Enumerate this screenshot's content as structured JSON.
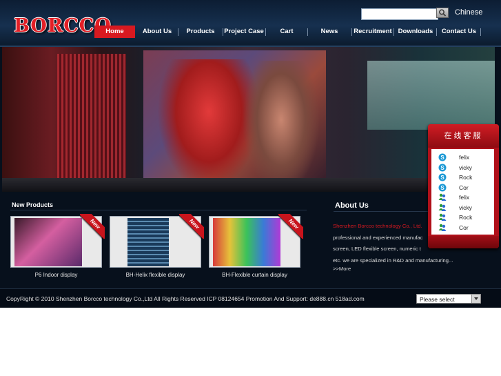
{
  "header": {
    "logo_text": "BORCCO",
    "search_placeholder": "",
    "language_link": "Chinese"
  },
  "nav": {
    "items": [
      {
        "label": "Home",
        "active": true
      },
      {
        "label": "About Us"
      },
      {
        "label": "Products"
      },
      {
        "label": "Project Case"
      },
      {
        "label": "Cart"
      },
      {
        "label": "News"
      },
      {
        "label": "Recruitment"
      },
      {
        "label": "Downloads"
      },
      {
        "label": "Contact Us"
      }
    ]
  },
  "new_products": {
    "title": "New Products",
    "badge": "New",
    "items": [
      {
        "label": "P6 Indoor display"
      },
      {
        "label": "BH-Helix flexible display"
      },
      {
        "label": "BH-Flexible curtain display"
      }
    ]
  },
  "about": {
    "title": "About Us",
    "highlight": "Shenzhen Borcco technology Co., Ltd.",
    "lines": [
      "professional and experienced manufac",
      "screen, LED flexible screen, numeric t",
      "etc. we are specialized in R&D and manufacturing..."
    ],
    "more_link": ">>More"
  },
  "service": {
    "title": "在线客服",
    "agents": [
      {
        "name": "felix",
        "icon": "skype-icon"
      },
      {
        "name": "vicky",
        "icon": "skype-icon"
      },
      {
        "name": "Rock",
        "icon": "skype-icon"
      },
      {
        "name": "Cor",
        "icon": "skype-icon"
      },
      {
        "name": "felix",
        "icon": "msn-icon"
      },
      {
        "name": "vicky",
        "icon": "msn-icon"
      },
      {
        "name": "Rock",
        "icon": "msn-icon"
      },
      {
        "name": "Cor",
        "icon": "msn-icon"
      }
    ]
  },
  "footer": {
    "copyright": "CopyRight © 2010 Shenzhen Borcco technology Co.,Ltd All Rights Reserved  ICP 08124654     Promotion And Support: de888.cn 518ad.com",
    "select_value": "Please select"
  },
  "colors": {
    "brand_red": "#d81920",
    "background": "#07101c"
  }
}
